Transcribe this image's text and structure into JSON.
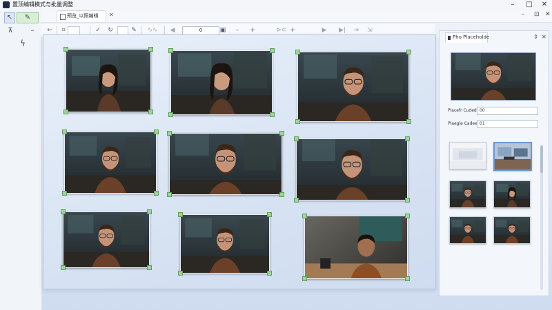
{
  "window": {
    "title": "置顶编辑模式与批量调整",
    "controls": [
      "–",
      "□",
      "✕"
    ]
  },
  "left_rail": {
    "buttons": [
      {
        "icon": "arrow-select-icon",
        "glyph": "↖"
      },
      {
        "icon": "pen-icon",
        "glyph": "✎"
      },
      {
        "icon": "pin-icon",
        "glyph": "⊼"
      },
      {
        "icon": "minus-icon",
        "glyph": "–"
      },
      {
        "icon": "lightning-icon",
        "glyph": "ϟ"
      }
    ]
  },
  "tabs": {
    "document_tab": "预览_以照编辑",
    "close_glyph": "✕",
    "window_controls": [
      "–",
      "⊡",
      "✕"
    ]
  },
  "toolbar": {
    "field_value": "0"
  },
  "canvas": {
    "photos": [
      {
        "subject": "woman-portrait"
      },
      {
        "subject": "woman-portrait"
      },
      {
        "subject": "man-portrait"
      },
      {
        "subject": "man-portrait"
      },
      {
        "subject": "man-portrait"
      },
      {
        "subject": "man-portrait"
      },
      {
        "subject": "man-portrait"
      },
      {
        "subject": "man-portrait"
      },
      {
        "subject": "man-portrait"
      }
    ]
  },
  "right_panel": {
    "tab_label": "Pho Placeholde",
    "fields": [
      {
        "label": "Placefr Cuded",
        "value": "00"
      },
      {
        "label": "Plaegle Cadeed",
        "value": "01"
      }
    ],
    "thumbnails": [
      {
        "subject": "blank-room",
        "selected": false
      },
      {
        "subject": "office-desk",
        "selected": true
      },
      {
        "subject": "man-portrait",
        "selected": false
      },
      {
        "subject": "woman-portrait",
        "selected": false
      },
      {
        "subject": "man-portrait",
        "selected": false
      },
      {
        "subject": "man-portrait",
        "selected": false
      }
    ],
    "controls": [
      "⇕",
      "✕"
    ]
  },
  "colors": {
    "accent": "#6e95cf",
    "handle": "#9fd39c",
    "background": "#dfe8f6"
  }
}
